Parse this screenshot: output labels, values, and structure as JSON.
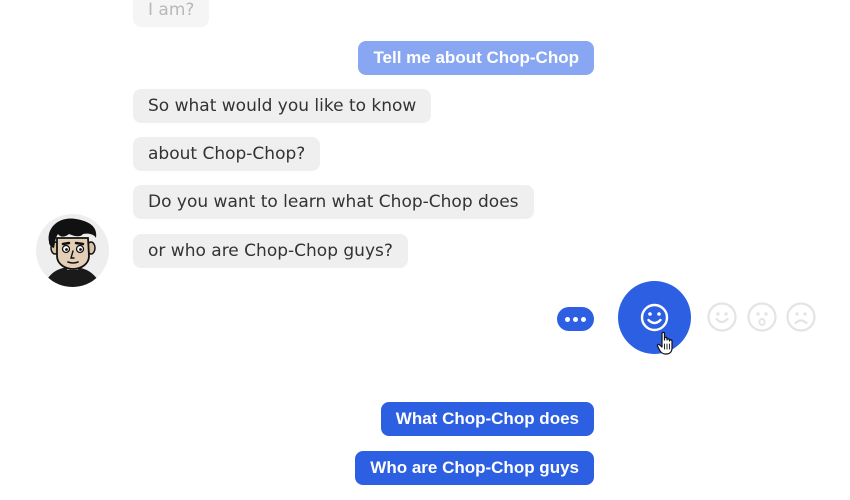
{
  "chat": {
    "bot_messages": [
      "I am?",
      "So what would you like to know",
      "about Chop-Chop?",
      "Do you want to learn what Chop-Chop does",
      "or who are Chop-Chop guys?"
    ],
    "user_message": "Tell me about Chop-Chop",
    "quick_replies": [
      "What Chop-Chop does",
      "Who are Chop-Chop guys"
    ]
  },
  "reactions": {
    "active": "smile-face-icon",
    "options": [
      "happy-face-icon",
      "surprised-face-icon",
      "sad-face-icon"
    ]
  },
  "colors": {
    "accent": "#2d5fe3",
    "user_bubble": "#88a6f2",
    "bot_bubble": "#efefef",
    "bot_text": "#333333",
    "faded_text": "#b8b8b8",
    "reaction_outline": "#e4e4e4"
  }
}
